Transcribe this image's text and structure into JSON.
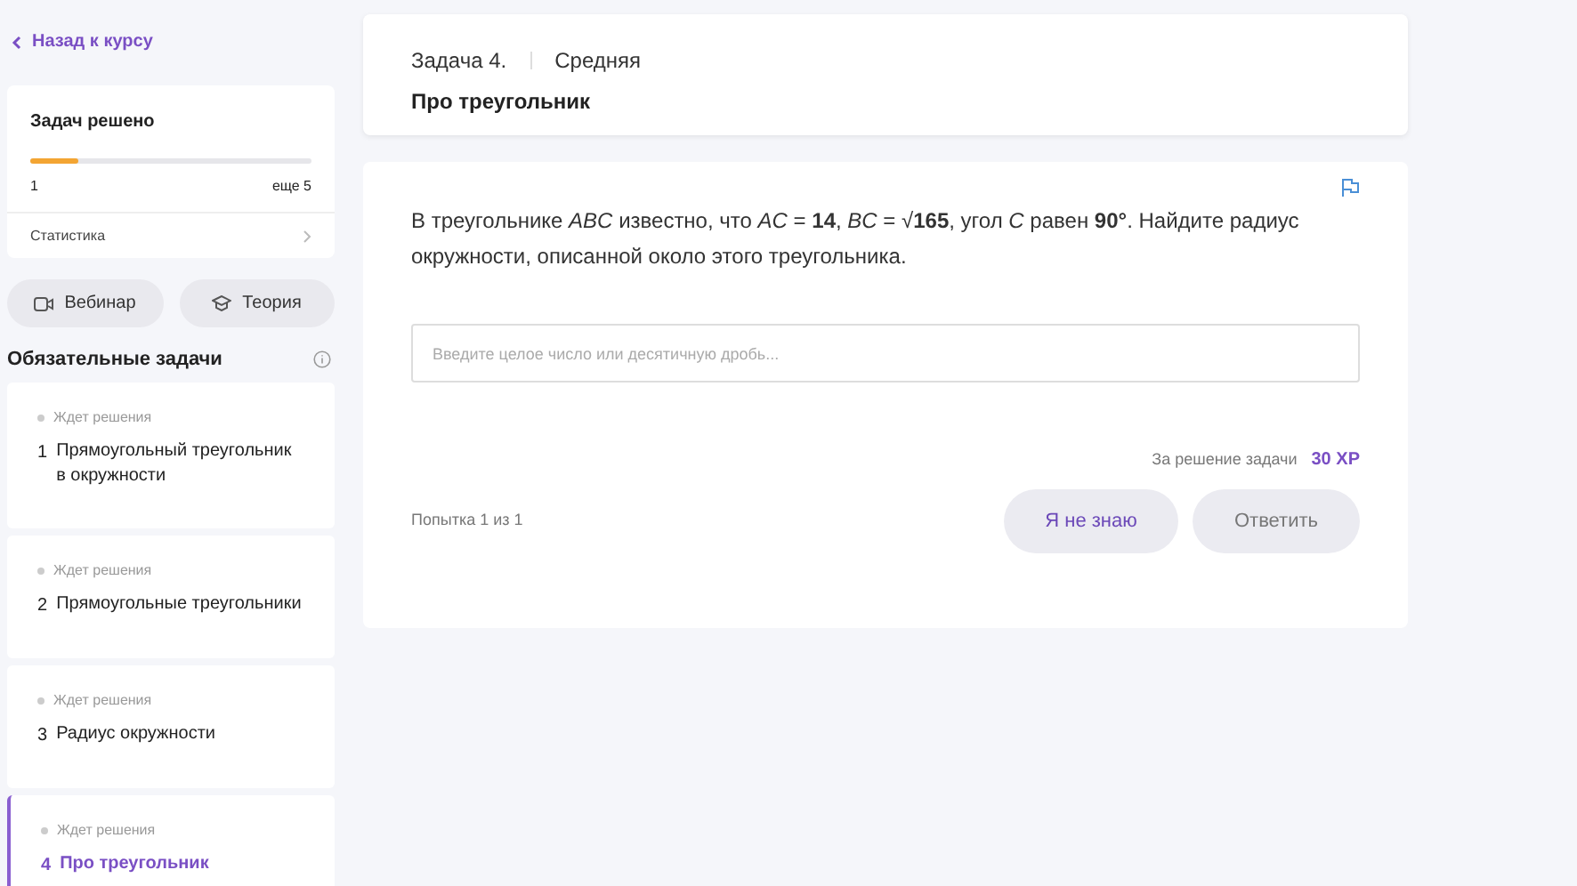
{
  "back_link": "Назад к курсу",
  "progress": {
    "title": "Задач решено",
    "level": 0.17,
    "solved": "1",
    "remaining": "еще 5",
    "stats_link": "Статистика"
  },
  "buttons": [
    {
      "kind": "video",
      "label": "Вебинар"
    },
    {
      "kind": "theory",
      "label": "Теория"
    }
  ],
  "tasks_section": {
    "title": "Обязательные задачи"
  },
  "tasks": [
    {
      "status": "Ждет решения",
      "number": "1",
      "title": "Прямоугольный треугольник в окружности",
      "selected": false
    },
    {
      "status": "Ждет решения",
      "number": "2",
      "title": "Прямоугольные треугольники",
      "selected": false
    },
    {
      "status": "Ждет решения",
      "number": "3",
      "title": "Радиус окружности",
      "selected": false
    },
    {
      "status": "Ждет решения",
      "number": "4",
      "title": "Про треугольник",
      "selected": true
    }
  ],
  "task_header": {
    "number": "Задача 4.",
    "difficulty": "Средняя",
    "title": "Про треугольник"
  },
  "problem": {
    "text": "В треугольнике *ABC* известно, что *AC* = **14**, *BC* = √**165**, угол *C* равен **90°**. Найдите радиус окружности, описанной около этого треугольника.",
    "answer_placeholder": "Введите целое число или десятичную дробь...",
    "reward_label": "За решение задачи",
    "reward": "30 XP",
    "attempts": "Попытка 1 из 1",
    "actions": [
      "Я не знаю",
      "Ответить"
    ]
  }
}
